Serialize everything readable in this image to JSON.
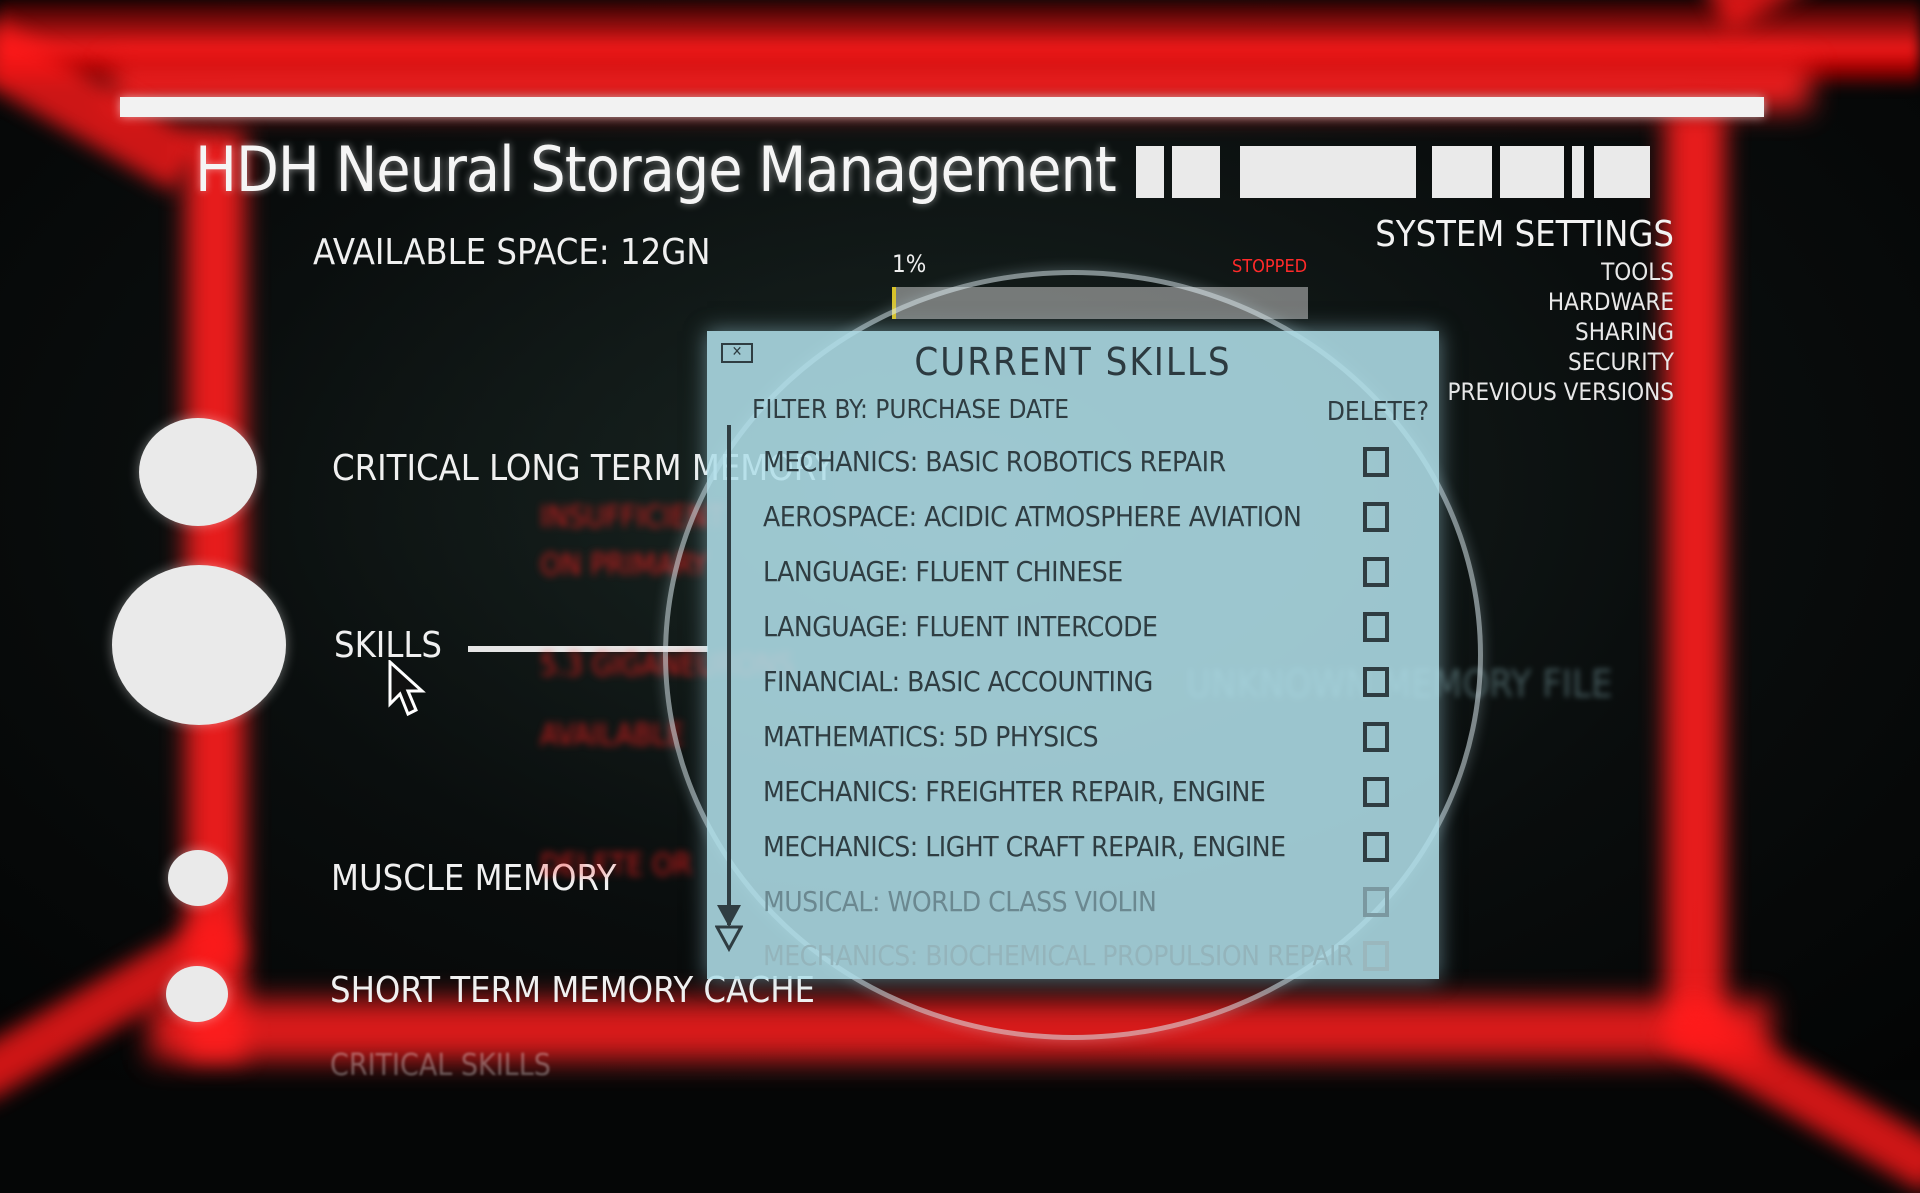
{
  "app_title": "HDH Neural Storage Management",
  "available_space": "AVAILABLE SPACE: 12GN",
  "progress": {
    "percent_label": "1%",
    "percent": 1,
    "status": "STOPPED",
    "fill_color": "#d8c22a"
  },
  "settings": {
    "title": "SYSTEM SETTINGS",
    "items": [
      "TOOLS",
      "HARDWARE",
      "SHARING",
      "SECURITY",
      "PREVIOUS VERSIONS"
    ]
  },
  "memory_menu": [
    {
      "label": "CRITICAL LONG TERM MEMORY"
    },
    {
      "label": "SKILLS"
    },
    {
      "label": "MUSCLE MEMORY"
    },
    {
      "label": "SHORT TERM MEMORY CACHE"
    },
    {
      "label": "CRITICAL SKILLS"
    }
  ],
  "skills_panel": {
    "close_icon": "close-icon",
    "title": "CURRENT SKILLS",
    "filter_label": "FILTER BY: PURCHASE DATE",
    "delete_header": "DELETE?",
    "skills": [
      {
        "name": "MECHANICS: BASIC ROBOTICS REPAIR",
        "delete": false
      },
      {
        "name": "AEROSPACE: ACIDIC ATMOSPHERE AVIATION",
        "delete": false
      },
      {
        "name": "LANGUAGE: FLUENT CHINESE",
        "delete": false
      },
      {
        "name": "LANGUAGE: FLUENT INTERCODE",
        "delete": false
      },
      {
        "name": "FINANCIAL: BASIC ACCOUNTING",
        "delete": false
      },
      {
        "name": "MATHEMATICS: 5D PHYSICS",
        "delete": false
      },
      {
        "name": "MECHANICS: FREIGHTER REPAIR, ENGINE",
        "delete": false
      },
      {
        "name": "MECHANICS: LIGHT CRAFT REPAIR, ENGINE",
        "delete": false
      },
      {
        "name": "MUSICAL:  WORLD  CLASS VIOLIN",
        "delete": false
      },
      {
        "name": "MECHANICS: BIOCHEMICAL PROPULSION REPAIR",
        "delete": false
      }
    ]
  },
  "background_file_label": "UNKNOWN MEMORY FILE",
  "colors": {
    "frame_red": "#ff1e1e",
    "panel_blue": "#afdee8",
    "panel_text": "#2f3d42"
  }
}
